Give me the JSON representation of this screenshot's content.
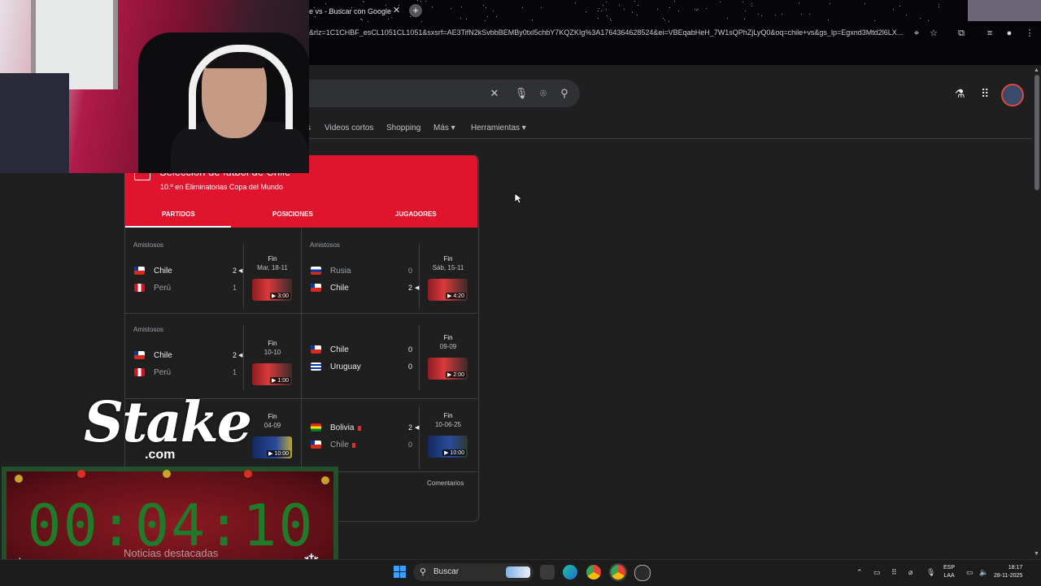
{
  "browser": {
    "tab_title": "e vs - Buscar con Google",
    "tab_close": "✕",
    "new_tab": "+",
    "url": "&rlz=1C1CHBF_esCL1051CL1051&sxsrf=AE3TifN2kSvbbBEMBy0txl5chbY7KQZKIg%3A1764364628524&ei=VBEqabHeH_7W1sQPhZjLyQ0&oq=chile+vs&gs_lp=Egxnd3Mtd2l6LX..."
  },
  "google": {
    "nav": [
      "Videos cortos",
      "Shopping",
      "Más ▾",
      "Herramientas ▾"
    ],
    "nav_partial": "s",
    "search_icons": {
      "clear": "✕",
      "mic": "🎙",
      "lens": "⌾",
      "search": "⚲"
    }
  },
  "card": {
    "team_name": "Selección de fútbol de Chile",
    "team_sub": "10.º en Eliminatorias Copa del Mundo",
    "tabs": [
      "PARTIDOS",
      "POSICIONES",
      "JUGADORES"
    ],
    "footer_link": "Comentarios",
    "matches": [
      {
        "comp": "Amistosos",
        "home": "Chile",
        "home_score": "2",
        "away": "Perú",
        "away_score": "1",
        "status": "Fin",
        "date": "Mar, 18-11",
        "duration": "▶ 3:00"
      },
      {
        "comp": "Amistosos",
        "home": "Rusia",
        "home_score": "0",
        "away": "Chile",
        "away_score": "2",
        "status": "Fin",
        "date": "Sáb, 15-11",
        "duration": "▶ 4:20"
      },
      {
        "comp": "Amistosos",
        "home": "Chile",
        "home_score": "2",
        "away": "Perú",
        "away_score": "1",
        "status": "Fin",
        "date": "10-10",
        "duration": "▶ 1:00"
      },
      {
        "comp": "",
        "home": "Chile",
        "home_score": "0",
        "away": "Uruguay",
        "away_score": "0",
        "status": "Fin",
        "date": "09-09",
        "duration": "▶ 2:00"
      },
      {
        "comp": "",
        "home": "",
        "home_score": "",
        "away": "",
        "away_score": "",
        "status": "Fin",
        "date": "04-09",
        "duration": "▶ 10:00"
      },
      {
        "comp": "",
        "home": "Bolivia",
        "home_score": "2",
        "away": "Chile",
        "away_score": "0",
        "status": "Fin",
        "date": "10-06-25",
        "duration": "▶ 10:00"
      }
    ]
  },
  "overlay": {
    "stake_text": "Stake",
    "stake_domain": ".com",
    "timer": "00:04:10",
    "behind_text": "Noticias destacadas"
  },
  "taskbar": {
    "search_label": "Buscar",
    "lang_top": "ESP",
    "lang_bottom": "LAA",
    "time": "18:17",
    "date": "28-11-2025"
  },
  "colors": {
    "card_red": "#e0142d",
    "page_bg": "#1f1f1f",
    "timer_green": "#1f7a2a"
  }
}
